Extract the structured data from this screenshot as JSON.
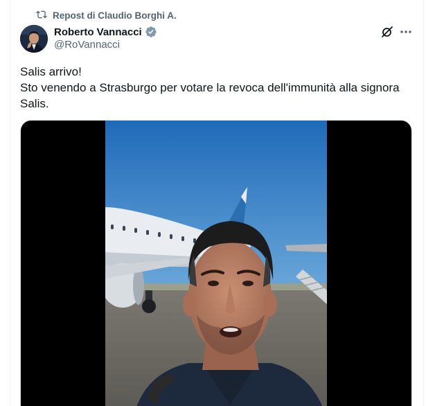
{
  "repost": {
    "label": "Repost di Claudio Borghi A.",
    "icon": "repost-icon"
  },
  "author": {
    "display_name": "Roberto Vannacci",
    "handle": "@RoVannacci",
    "verified_icon": "verified-badge-icon",
    "verified_color": "#829aab"
  },
  "actions": {
    "grok_icon": "grok-icon",
    "more_icon": "more-options-icon"
  },
  "tweet": {
    "line1": "Salis arrivo!",
    "line2": "Sto venendo a Strasburgo per votare la revoca dell'immunità alla signora",
    "line3": "Salis."
  },
  "media": {
    "type": "video",
    "icon": "video-thumbnail"
  },
  "colors": {
    "text_primary": "#0f1419",
    "text_secondary": "#536471",
    "media_letterbox": "#000000",
    "sky": "#2f79c4"
  }
}
